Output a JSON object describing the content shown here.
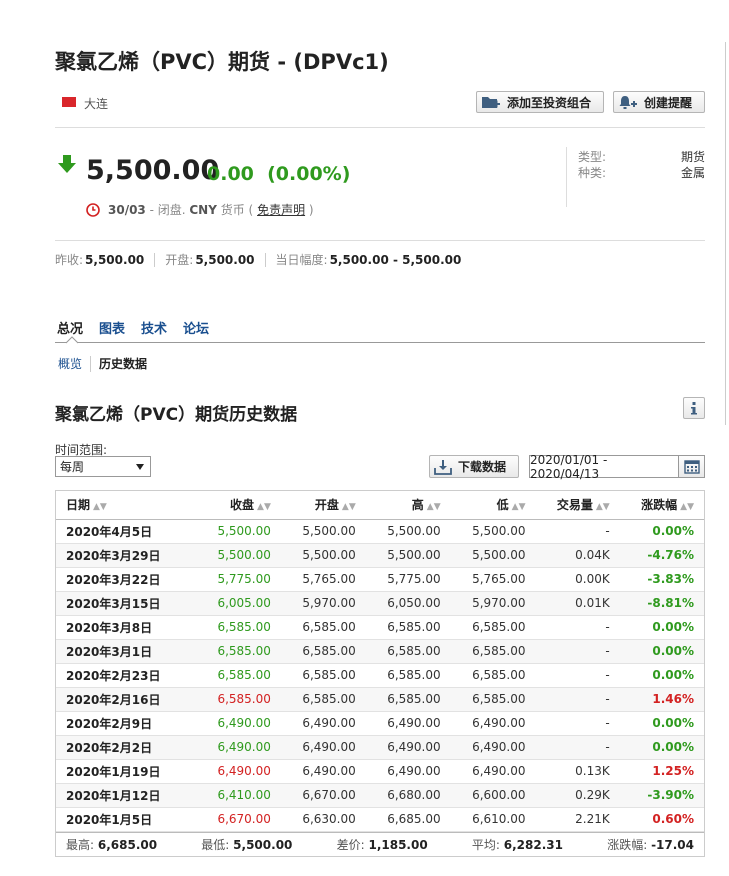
{
  "header": {
    "title": "聚氯乙烯（PVC）期货 - (DPVc1)",
    "exchange": "大连",
    "add_portfolio_label": "添加至投资组合",
    "create_alert_label": "创建提醒"
  },
  "quote": {
    "price": "5,500.00",
    "change": "0.00",
    "change_pct": "(0.00%)",
    "date": "30/03",
    "status_text": " - 闭盘. ",
    "currency_label": "CNY",
    "currency_suffix": " 货币 ( ",
    "disclaimer": "免责声明",
    "close_paren": " )"
  },
  "info": {
    "type_label": "类型:",
    "type_value": "期货",
    "category_label": "种类:",
    "category_value": "金属"
  },
  "stats": {
    "prev_close_label": "昨收:",
    "prev_close": "5,500.00",
    "open_label": "开盘:",
    "open": "5,500.00",
    "day_range_label": "当日幅度:",
    "day_range": "5,500.00 - 5,500.00"
  },
  "nav": {
    "tabs": [
      "总况",
      "图表",
      "技术",
      "论坛"
    ],
    "subtabs": [
      "概览",
      "历史数据"
    ]
  },
  "history": {
    "title": "聚氯乙烯（PVC）期货历史数据",
    "range_label": "时间范围:",
    "interval_selected": "每周",
    "download_label": "下载数据",
    "date_range": "2020/01/01 - 2020/04/13",
    "columns": [
      "日期",
      "收盘",
      "开盘",
      "高",
      "低",
      "交易量",
      "涨跌幅"
    ],
    "rows": [
      {
        "date": "2020年4月5日",
        "close": "5,500.00",
        "open": "5,500.00",
        "high": "5,500.00",
        "low": "5,500.00",
        "volume": "-",
        "change": "0.00%",
        "dir": "green"
      },
      {
        "date": "2020年3月29日",
        "close": "5,500.00",
        "open": "5,500.00",
        "high": "5,500.00",
        "low": "5,500.00",
        "volume": "0.04K",
        "change": "-4.76%",
        "dir": "green"
      },
      {
        "date": "2020年3月22日",
        "close": "5,775.00",
        "open": "5,765.00",
        "high": "5,775.00",
        "low": "5,765.00",
        "volume": "0.00K",
        "change": "-3.83%",
        "dir": "green"
      },
      {
        "date": "2020年3月15日",
        "close": "6,005.00",
        "open": "5,970.00",
        "high": "6,050.00",
        "low": "5,970.00",
        "volume": "0.01K",
        "change": "-8.81%",
        "dir": "green"
      },
      {
        "date": "2020年3月8日",
        "close": "6,585.00",
        "open": "6,585.00",
        "high": "6,585.00",
        "low": "6,585.00",
        "volume": "-",
        "change": "0.00%",
        "dir": "green"
      },
      {
        "date": "2020年3月1日",
        "close": "6,585.00",
        "open": "6,585.00",
        "high": "6,585.00",
        "low": "6,585.00",
        "volume": "-",
        "change": "0.00%",
        "dir": "green"
      },
      {
        "date": "2020年2月23日",
        "close": "6,585.00",
        "open": "6,585.00",
        "high": "6,585.00",
        "low": "6,585.00",
        "volume": "-",
        "change": "0.00%",
        "dir": "green"
      },
      {
        "date": "2020年2月16日",
        "close": "6,585.00",
        "open": "6,585.00",
        "high": "6,585.00",
        "low": "6,585.00",
        "volume": "-",
        "change": "1.46%",
        "dir": "red"
      },
      {
        "date": "2020年2月9日",
        "close": "6,490.00",
        "open": "6,490.00",
        "high": "6,490.00",
        "low": "6,490.00",
        "volume": "-",
        "change": "0.00%",
        "dir": "green"
      },
      {
        "date": "2020年2月2日",
        "close": "6,490.00",
        "open": "6,490.00",
        "high": "6,490.00",
        "low": "6,490.00",
        "volume": "-",
        "change": "0.00%",
        "dir": "green"
      },
      {
        "date": "2020年1月19日",
        "close": "6,490.00",
        "open": "6,490.00",
        "high": "6,490.00",
        "low": "6,490.00",
        "volume": "0.13K",
        "change": "1.25%",
        "dir": "red"
      },
      {
        "date": "2020年1月12日",
        "close": "6,410.00",
        "open": "6,670.00",
        "high": "6,680.00",
        "low": "6,600.00",
        "volume": "0.29K",
        "change": "-3.90%",
        "dir": "green"
      },
      {
        "date": "2020年1月5日",
        "close": "6,670.00",
        "open": "6,630.00",
        "high": "6,685.00",
        "low": "6,610.00",
        "volume": "2.21K",
        "change": "0.60%",
        "dir": "red"
      }
    ],
    "summary": {
      "high_label": "最高:",
      "high": "6,685.00",
      "low_label": "最低:",
      "low": "5,500.00",
      "diff_label": "差价:",
      "diff": "1,185.00",
      "avg_label": "平均:",
      "avg": "6,282.31",
      "change_label": "涨跌幅:",
      "change": "-17.04"
    }
  },
  "colors": {
    "up_green": "#2f9a1e",
    "down_red": "#d32222",
    "link_blue": "#1a4f8f"
  }
}
